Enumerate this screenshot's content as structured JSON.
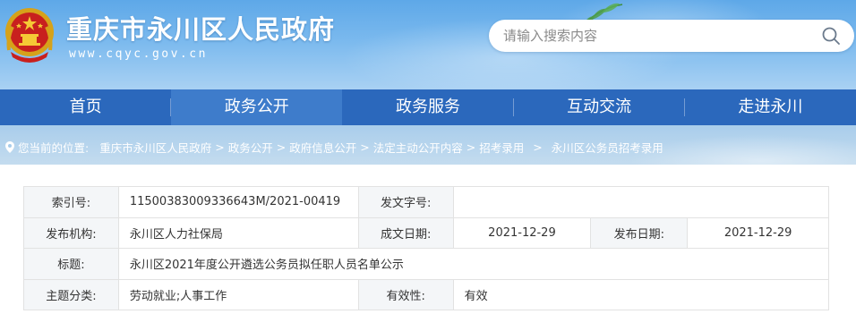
{
  "header": {
    "site_title": "重庆市永川区人民政府",
    "site_url": "www.cqyc.gov.cn",
    "search_placeholder": "请输入搜索内容"
  },
  "nav": {
    "items": [
      {
        "label": "首页"
      },
      {
        "label": "政务公开"
      },
      {
        "label": "政务服务"
      },
      {
        "label": "互动交流"
      },
      {
        "label": "走进永川"
      }
    ],
    "active_index": 1
  },
  "breadcrumb": {
    "prefix": "您当前的位置:",
    "items": [
      "重庆市永川区人民政府",
      "政务公开",
      "政府信息公开",
      "法定主动公开内容",
      "招考录用",
      "永川区公务员招考录用"
    ],
    "separator": ">"
  },
  "info": {
    "index_label": "索引号:",
    "index_value": "11500383009336643M/2021-00419",
    "doc_no_label": "发文字号:",
    "doc_no_value": "",
    "publisher_label": "发布机构:",
    "publisher_value": "永川区人力社保局",
    "created_label": "成文日期:",
    "created_value": "2021-12-29",
    "published_label": "发布日期:",
    "published_value": "2021-12-29",
    "title_label": "标题:",
    "title_value": "永川区2021年度公开遴选公务员拟任职人员名单公示",
    "topic_label": "主题分类:",
    "topic_value": "劳动就业;人事工作",
    "validity_label": "有效性:",
    "validity_value": "有效"
  },
  "colors": {
    "nav_bg": "#2b68bc",
    "nav_active": "#3e7ccb",
    "header_sky": "#5ea8e8",
    "label_bg": "#f4f6f8"
  },
  "icons": {
    "emblem": "national-emblem-icon",
    "search": "search-icon",
    "location": "location-pin-icon"
  }
}
